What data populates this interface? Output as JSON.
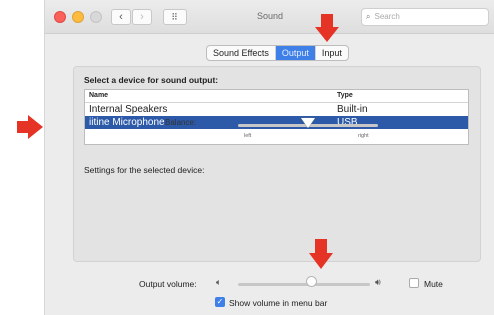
{
  "window": {
    "title": "Sound",
    "back_glyph": "‹",
    "forward_glyph": "›",
    "grid_glyph": "⠿",
    "search_placeholder": "Search"
  },
  "tabs": [
    {
      "label": "Sound Effects"
    },
    {
      "label": "Output",
      "active": true
    },
    {
      "label": "Input"
    }
  ],
  "output": {
    "section_title": "Select a device for sound output:",
    "columns": [
      "Name",
      "Type"
    ],
    "devices": [
      {
        "name": "Internal Speakers",
        "type": "Built-in",
        "selected": false
      },
      {
        "name": "iitine Microphone",
        "type": "USB",
        "selected": true
      }
    ],
    "settings_title": "Settings for the selected device:",
    "balance": {
      "label": "Balance:",
      "left_label": "left",
      "right_label": "right",
      "value": 0.5
    }
  },
  "volume": {
    "label": "Output volume:",
    "low_icon": "speaker-low-icon",
    "high_icon": "speaker-high-icon",
    "value": 0.55,
    "mute_label": "Mute",
    "mute_checked": false,
    "show_in_menu_bar_label": "Show volume in menu bar",
    "show_in_menu_bar_checked": true
  },
  "colors": {
    "accent": "#3f7fe8",
    "selection": "#2c5aa8",
    "annotation_arrow": "#e53425"
  }
}
